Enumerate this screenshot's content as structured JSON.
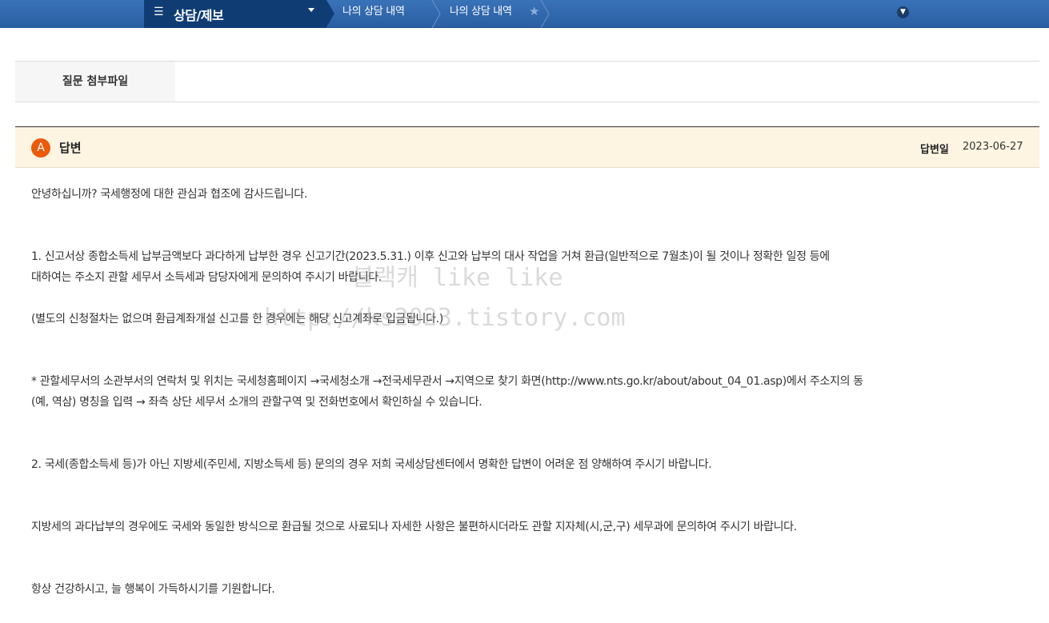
{
  "nav": {
    "menu_title": "상담/제보",
    "crumbs": [
      "나의 상담 내역",
      "나의 상담 내역"
    ]
  },
  "attachment": {
    "label": "질문 첨부파일"
  },
  "answer": {
    "badge": "A",
    "title": "답변",
    "date_label": "답변일",
    "date": "2023-06-27"
  },
  "body": {
    "greeting": "안녕하십니까? 국세행정에 대한 관심과 협조에 감사드립니다.",
    "p1_line1": "1. 신고서상 종합소득세 납부금액보다 과다하게 납부한 경우 신고기간(2023.5.31.) 이후 신고와 납부의 대사 작업을 거쳐 환급(일반적으로 7월초)이 될 것이나 정확한 일정 등에",
    "p1_line2": "대하여는 주소지 관할 세무서 소득세과 담당자에게 문의하여 주시기 바랍니다.",
    "p1_note": "(별도의 신청절차는 없으며 환급계좌개설 신고를 한 경우에는 해당 신고계좌로 입금됩니다.)",
    "p2_line1": "* 관할세무서의 소관부서의 연락처 및 위치는 국세청홈페이지 →국세청소개 →전국세무관서 →지역으로 찾기 화면(http://www.nts.go.kr/about/about_04_01.asp)에서 주소지의 동",
    "p2_line2": "(예, 역삼) 명칭을 입력 → 좌측 상단 세무서 소개의 관할구역 및 전화번호에서 확인하실 수 있습니다.",
    "p3": "2. 국세(종합소득세 등)가 아닌 지방세(주민세, 지방소득세 등) 문의의 경우 저희 국세상담센터에서 명확한 답변이 어려운 점 양해하여 주시기 바랍니다.",
    "p4": "지방세의 과다납부의 경우에도 국세와 동일한 방식으로 환급될 것으로 사료되나 자세한 사항은 불편하시더라도 관할 지자체(시,군,구) 세무과에 문의하여 주시기 바랍니다.",
    "closing": "항상 건강하시고, 늘 행복이 가득하시기를 기원합니다."
  },
  "watermark": {
    "line1": "블랙캐 like like",
    "line2": "http://ks2023.tistory.com"
  }
}
